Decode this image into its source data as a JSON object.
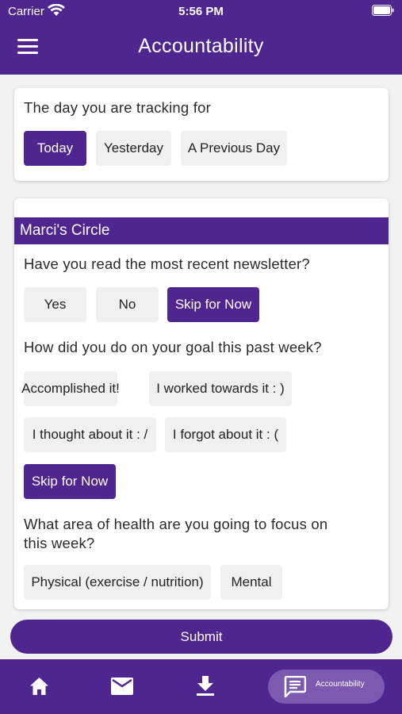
{
  "status_bar": {
    "carrier": "Carrier",
    "time": "5:56 PM"
  },
  "header": {
    "title": "Accountability"
  },
  "tracking": {
    "question": "The day you are tracking for",
    "options": [
      "Today",
      "Yesterday",
      "A Previous Day"
    ]
  },
  "circle": {
    "title": "Marci's Circle",
    "q1": {
      "text": "Have you read the most recent newsletter?",
      "options": [
        "Yes",
        "No",
        "Skip for Now"
      ]
    },
    "q2": {
      "text": "How did you do on your goal this past week?",
      "options": [
        "Accomplished it!",
        "I worked towards it : )",
        "I thought about it : /",
        "I forgot about it : (",
        "Skip for Now"
      ]
    },
    "q3": {
      "line1": "What area of health are you going to focus on",
      "line2": "this week?",
      "options": [
        "Physical (exercise / nutrition)",
        "Mental"
      ]
    }
  },
  "submit_label": "Submit",
  "tabbar": {
    "active_label": "Accountability"
  },
  "colors": {
    "primary": "#4f2690",
    "button_bg": "#f0f0f0",
    "tab_active": "#7c5ab0"
  }
}
